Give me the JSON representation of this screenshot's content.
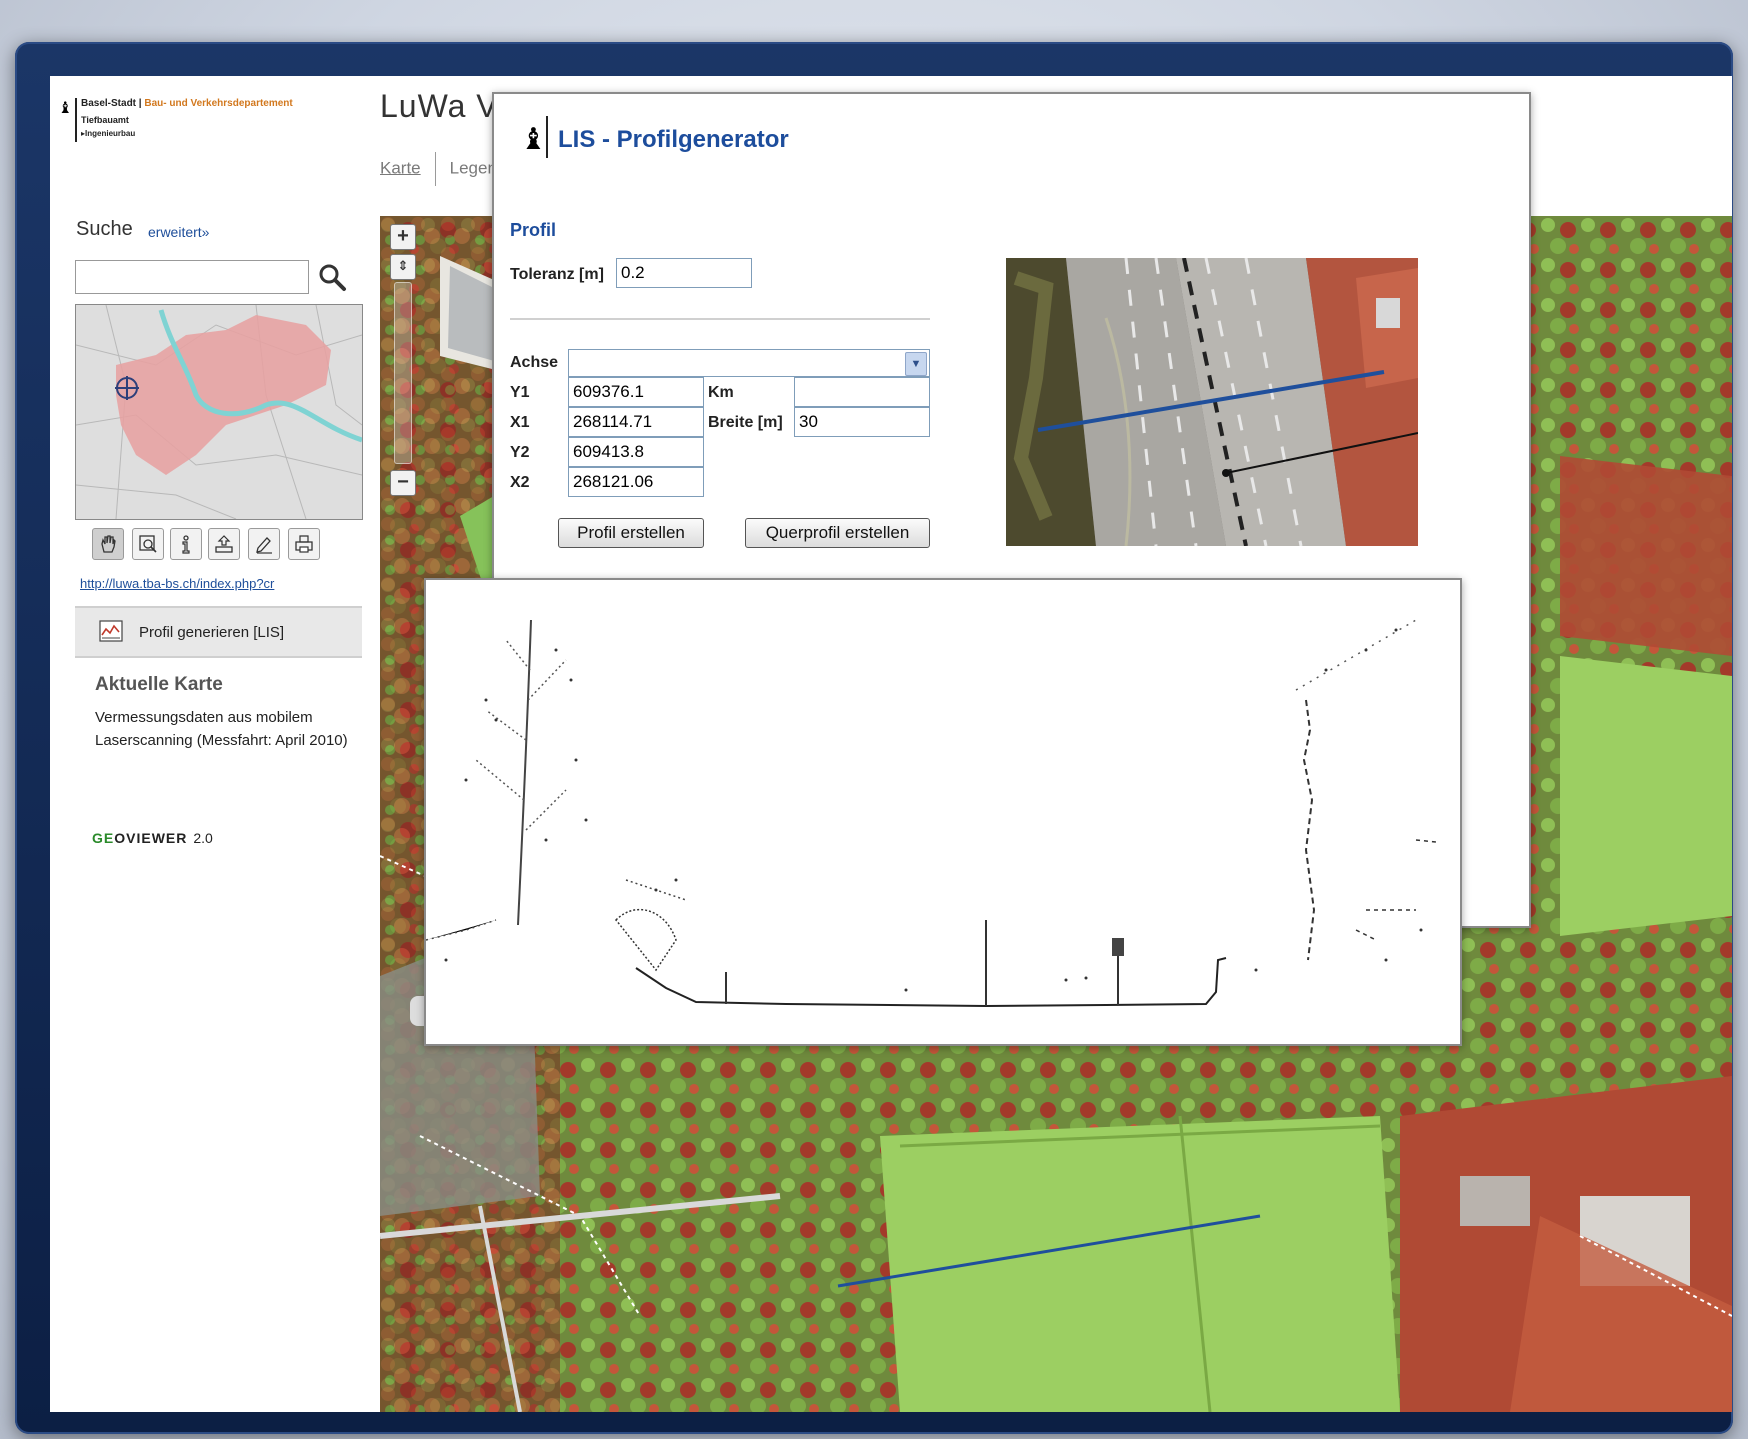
{
  "header": {
    "org_name": "Basel-Stadt",
    "org_department": "Bau- und Verkehrsdepartement",
    "org_office": "Tiefbauamt",
    "org_unit": "▸Ingenieurbau",
    "app_title": "LuWa Ver"
  },
  "tabs": [
    "Karte",
    "Legende"
  ],
  "sidebar": {
    "search_label": "Suche",
    "search_advanced_link": "erweitert»",
    "search_value": "",
    "tools": [
      "pan-icon",
      "zoom-box-icon",
      "info-icon",
      "upload-icon",
      "edit-icon",
      "print-icon"
    ],
    "url_link": "http://luwa.tba-bs.ch/index.php?cr",
    "profil_button_label": "Profil generieren [LIS]",
    "aktuelle_karte_title": "Aktuelle Karte",
    "aktuelle_karte_text": "Vermessungsdaten aus mobilem Laserscanning (Messfahrt: April 2010)",
    "geoviewer_brand_green": "GE",
    "geoviewer_brand_rest": "OVIEWER",
    "geoviewer_version": "2.0"
  },
  "map": {
    "zoom_in": "+",
    "zoom_out": "−"
  },
  "dialog": {
    "title": "LIS - Profilgenerator",
    "section_title": "Profil",
    "toleranz_label": "Toleranz [m]",
    "toleranz_value": "0.2",
    "achse_label": "Achse",
    "achse_value": "",
    "y1_label": "Y1",
    "y1_value": "609376.1",
    "x1_label": "X1",
    "x1_value": "268114.71",
    "y2_label": "Y2",
    "y2_value": "609413.8",
    "x2_label": "X2",
    "x2_value": "268121.06",
    "km_label": "Km",
    "km_value": "",
    "breite_label": "Breite [m]",
    "breite_value": "30",
    "btn_profil": "Profil erstellen",
    "btn_querprofil": "Querprofil erstellen"
  },
  "colors": {
    "frame": "#15305e",
    "title_blue": "#1d4d9c",
    "link_blue": "#1e4e9a",
    "department_orange": "#d2781e",
    "profile_line": "#1f4f9c"
  }
}
